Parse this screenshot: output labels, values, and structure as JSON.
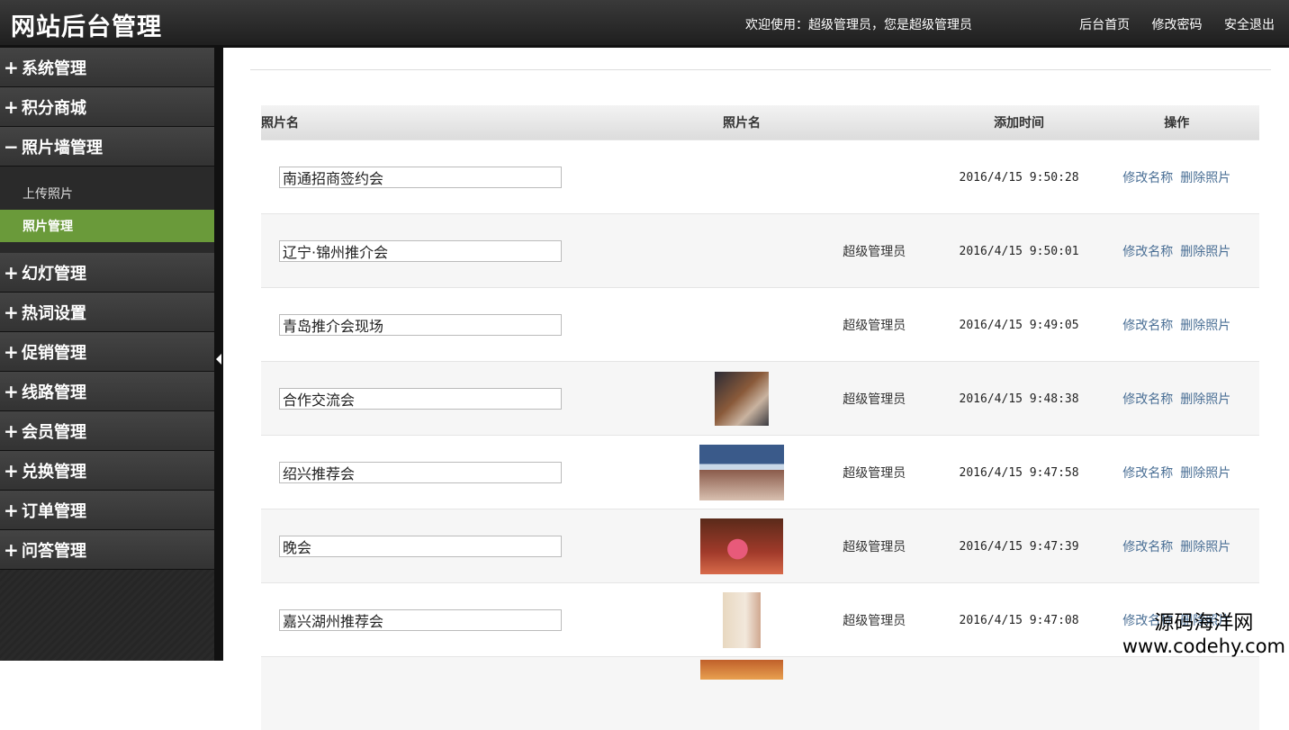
{
  "header": {
    "title": "网站后台管理",
    "welcome": "欢迎使用：超级管理员，您是超级管理员",
    "links": [
      "后台首页",
      "修改密码",
      "安全退出"
    ]
  },
  "sidebar": {
    "groups_before": [
      {
        "sign": "+",
        "label": "系统管理"
      },
      {
        "sign": "+",
        "label": "积分商城"
      },
      {
        "sign": "−",
        "label": "照片墙管理"
      }
    ],
    "sub_items": [
      {
        "label": "上传照片",
        "active": false
      },
      {
        "label": "照片管理",
        "active": true
      }
    ],
    "groups_after": [
      {
        "sign": "+",
        "label": "幻灯管理"
      },
      {
        "sign": "+",
        "label": "热词设置"
      },
      {
        "sign": "+",
        "label": "促销管理"
      },
      {
        "sign": "+",
        "label": "线路管理"
      },
      {
        "sign": "+",
        "label": "会员管理"
      },
      {
        "sign": "+",
        "label": "兑换管理"
      },
      {
        "sign": "+",
        "label": "订单管理"
      },
      {
        "sign": "+",
        "label": "问答管理"
      }
    ]
  },
  "table": {
    "headers": [
      "照片名",
      "照片名",
      "添加时间",
      "操作"
    ],
    "ops": {
      "rename": "修改名称",
      "delete": "删除照片"
    },
    "rows": [
      {
        "name": "南通招商签约会",
        "thumb": "",
        "uploader": "",
        "time": "2016/4/15 9:50:28"
      },
      {
        "name": "辽宁·锦州推介会",
        "thumb": "",
        "uploader": "超级管理员",
        "time": "2016/4/15 9:50:01"
      },
      {
        "name": "青岛推介会现场",
        "thumb": "",
        "uploader": "超级管理员",
        "time": "2016/4/15 9:49:05"
      },
      {
        "name": "合作交流会",
        "thumb": "t1",
        "uploader": "超级管理员",
        "time": "2016/4/15 9:48:38"
      },
      {
        "name": "绍兴推荐会",
        "thumb": "t2",
        "uploader": "超级管理员",
        "time": "2016/4/15 9:47:58"
      },
      {
        "name": "晚会",
        "thumb": "t3",
        "uploader": "超级管理员",
        "time": "2016/4/15 9:47:39"
      },
      {
        "name": "嘉兴湖州推荐会",
        "thumb": "t4",
        "uploader": "超级管理员",
        "time": "2016/4/15 9:47:08"
      },
      {
        "name": "",
        "thumb": "t5",
        "uploader": "",
        "time": ""
      }
    ]
  },
  "watermark": {
    "line1": "源码海洋网",
    "line2": "www.codehy.com"
  }
}
